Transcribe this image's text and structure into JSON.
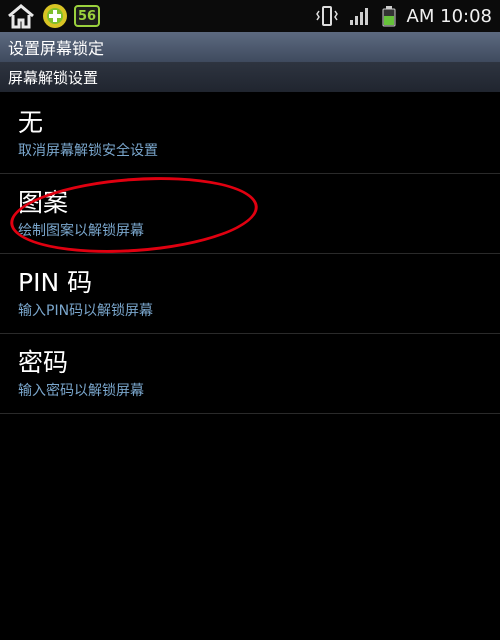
{
  "status_bar": {
    "icons_left": [
      "home-icon",
      "plus-circle-icon",
      "badge-56-icon"
    ],
    "badge_text": "56",
    "icons_right": [
      "vibrate-icon",
      "signal-icon",
      "battery-icon"
    ],
    "time": "AM 10:08",
    "colors": {
      "badge": "#9bd13d",
      "battery": "#66c23a"
    }
  },
  "title": "设置屏幕锁定",
  "section": "屏幕解锁设置",
  "items": [
    {
      "title": "无",
      "subtitle": "取消屏幕解锁安全设置"
    },
    {
      "title": "图案",
      "subtitle": "绘制图案以解锁屏幕"
    },
    {
      "title": "PIN 码",
      "subtitle": "输入PIN码以解锁屏幕"
    },
    {
      "title": "密码",
      "subtitle": "输入密码以解锁屏幕"
    }
  ],
  "colors": {
    "subtitle": "#7aa6cc",
    "title_bar": "#4b5669",
    "annotation": "#e00010"
  }
}
